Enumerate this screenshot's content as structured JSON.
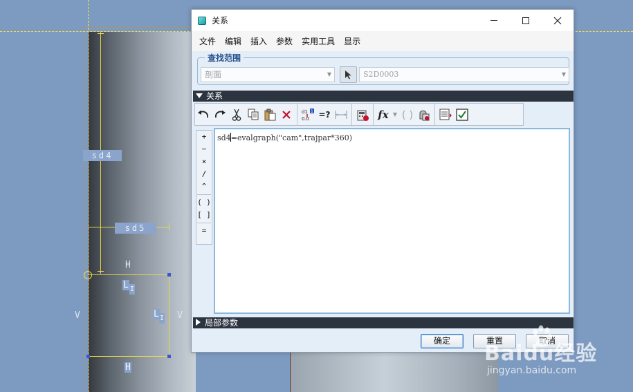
{
  "window": {
    "title": "关系"
  },
  "menu": [
    "文件",
    "编辑",
    "插入",
    "参数",
    "实用工具",
    "显示"
  ],
  "lookup": {
    "group_title": "查找范围",
    "type_value": "剖面",
    "item_value": "S2D0003"
  },
  "relations": {
    "section_title": "关系",
    "text": "sd4=evalgraph(\"cam\",trajpar*360)",
    "text_before_caret": "sd4",
    "text_after_caret": "=evalgraph(\"cam\",trajpar*360)",
    "operators": [
      "+",
      "−",
      "×",
      "/",
      "^",
      "( )",
      "[ ]",
      "="
    ],
    "fx_label": "fx",
    "verify_label": "=?"
  },
  "local_params": {
    "section_title": "局部参数"
  },
  "buttons": {
    "ok": "确定",
    "reset": "重置",
    "cancel": "取消"
  },
  "cad": {
    "dim_sd4": "sd4",
    "dim_sd5": "sd5",
    "h_top": "H",
    "h_bottom": "H",
    "v_left": "V",
    "v_right": "V",
    "l1": "L",
    "l1_sub": "I",
    "l2": "L",
    "l2_sub": "I"
  },
  "watermark": {
    "brand": "Baidu经验",
    "url": "jingyan.baidu.com"
  },
  "colors": {
    "accent": "#274f8a",
    "section_bar": "#2c3440",
    "cad_background": "#7d9ac0",
    "sketch_yellow": "#e8d64a"
  }
}
